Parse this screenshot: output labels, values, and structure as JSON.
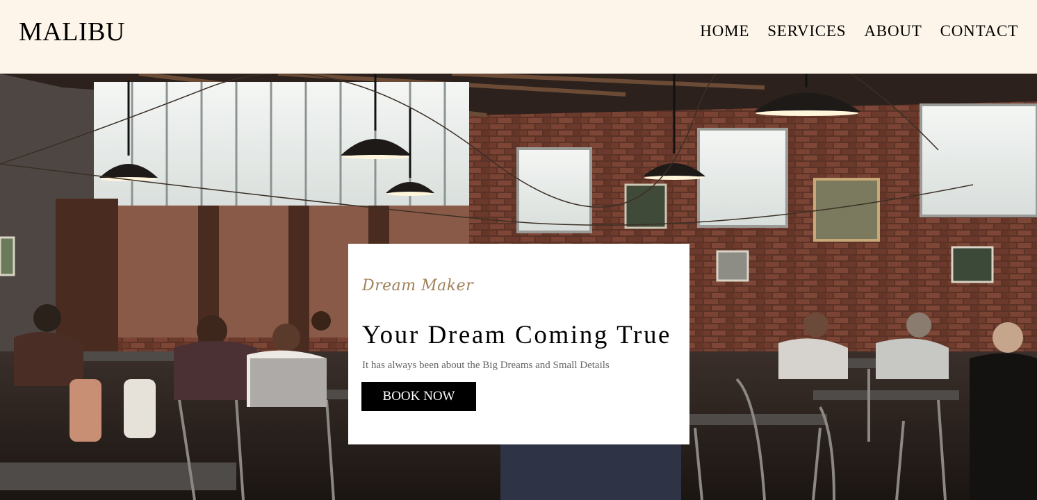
{
  "brand": {
    "logo": "MALIBU"
  },
  "nav": {
    "items": [
      "HOME",
      "SERVICES",
      "ABOUT",
      "CONTACT"
    ]
  },
  "hero": {
    "script_tagline": "Dream Maker",
    "title": "Your Dream Coming True",
    "description": "It has always been about the Big Dreams and Small Details",
    "cta_label": "BOOK NOW"
  },
  "colors": {
    "header_bg": "#fdf5e9",
    "tagline": "#a0815a",
    "cta_bg": "#000000",
    "card_bg": "#ffffff"
  }
}
